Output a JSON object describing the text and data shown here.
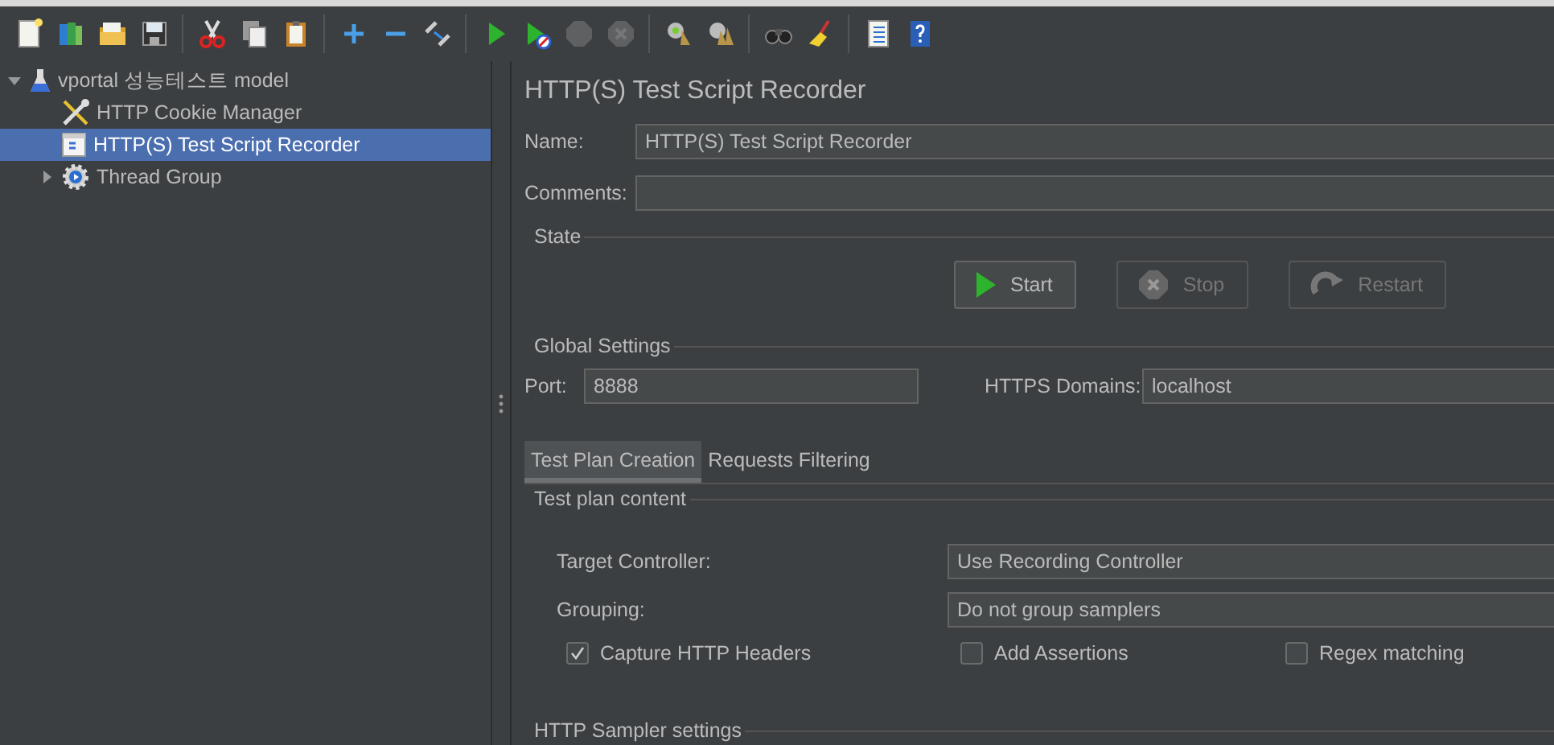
{
  "toolbar": [
    {
      "kind": "new",
      "disabled": false
    },
    {
      "kind": "templates",
      "disabled": false
    },
    {
      "kind": "open",
      "disabled": false
    },
    {
      "kind": "save",
      "disabled": false
    },
    {
      "kind": "sep"
    },
    {
      "kind": "cut",
      "disabled": false
    },
    {
      "kind": "copy",
      "disabled": false
    },
    {
      "kind": "paste",
      "disabled": false
    },
    {
      "kind": "sep"
    },
    {
      "kind": "expand",
      "disabled": false
    },
    {
      "kind": "collapse",
      "disabled": false
    },
    {
      "kind": "toggle",
      "disabled": false
    },
    {
      "kind": "sep"
    },
    {
      "kind": "start",
      "disabled": false
    },
    {
      "kind": "start_no_pause",
      "disabled": false
    },
    {
      "kind": "stop",
      "disabled": true
    },
    {
      "kind": "shutdown",
      "disabled": true
    },
    {
      "kind": "sep"
    },
    {
      "kind": "clear",
      "disabled": false
    },
    {
      "kind": "clear_all",
      "disabled": false
    },
    {
      "kind": "sep"
    },
    {
      "kind": "search",
      "disabled": false
    },
    {
      "kind": "reset_search",
      "disabled": false
    },
    {
      "kind": "sep"
    },
    {
      "kind": "function",
      "disabled": false
    },
    {
      "kind": "help",
      "disabled": false
    }
  ],
  "tree": [
    {
      "label": "vportal 성능테스트 model",
      "kind": "plan",
      "expanded": true,
      "selected": false,
      "children": [
        {
          "label": "HTTP Cookie Manager",
          "kind": "config",
          "selected": false
        },
        {
          "label": "HTTP(S) Test Script Recorder",
          "kind": "recorder",
          "selected": true
        },
        {
          "label": "Thread Group",
          "kind": "threads",
          "expanded": false,
          "selected": false
        }
      ]
    }
  ],
  "panel": {
    "title": "HTTP(S) Test Script Recorder",
    "name": {
      "label": "Name:",
      "value": "HTTP(S) Test Script Recorder"
    },
    "comments": {
      "label": "Comments:"
    },
    "state": {
      "title": "State",
      "buttons": [
        {
          "label": "Start",
          "kind": "start",
          "disabled": false
        },
        {
          "label": "Stop",
          "kind": "stop",
          "disabled": true
        },
        {
          "label": "Restart",
          "kind": "restart",
          "disabled": true
        }
      ]
    },
    "global_settings": {
      "title": "Global Settings",
      "port": {
        "label": "Port:",
        "value": "8888"
      },
      "https_domains": {
        "label": "HTTPS Domains:",
        "value": "localhost"
      }
    },
    "tabs": [
      {
        "label": "Test Plan Creation",
        "selected": true
      },
      {
        "label": "Requests Filtering",
        "selected": false
      }
    ],
    "test_plan_content": {
      "title": "Test plan content",
      "target_controller": {
        "label": "Target Controller:",
        "value": "Use Recording Controller"
      },
      "grouping": {
        "label": "Grouping:",
        "value": "Do not group samplers"
      },
      "checkboxes": [
        {
          "label": "Capture HTTP Headers",
          "checked": true
        },
        {
          "label": "Add Assertions",
          "checked": false
        },
        {
          "label": "Regex matching",
          "checked": false
        }
      ]
    },
    "http_sampler_settings": {
      "title": "HTTP Sampler settings"
    }
  }
}
